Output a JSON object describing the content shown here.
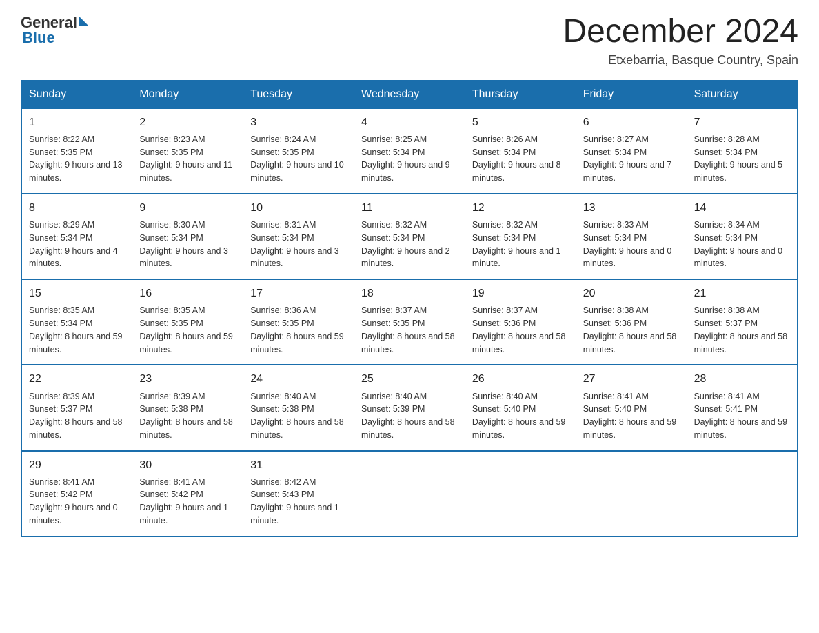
{
  "header": {
    "logo_general": "General",
    "logo_blue": "Blue",
    "month_title": "December 2024",
    "subtitle": "Etxebarria, Basque Country, Spain"
  },
  "weekdays": [
    "Sunday",
    "Monday",
    "Tuesday",
    "Wednesday",
    "Thursday",
    "Friday",
    "Saturday"
  ],
  "weeks": [
    [
      {
        "day": "1",
        "sunrise": "8:22 AM",
        "sunset": "5:35 PM",
        "daylight": "9 hours and 13 minutes."
      },
      {
        "day": "2",
        "sunrise": "8:23 AM",
        "sunset": "5:35 PM",
        "daylight": "9 hours and 11 minutes."
      },
      {
        "day": "3",
        "sunrise": "8:24 AM",
        "sunset": "5:35 PM",
        "daylight": "9 hours and 10 minutes."
      },
      {
        "day": "4",
        "sunrise": "8:25 AM",
        "sunset": "5:34 PM",
        "daylight": "9 hours and 9 minutes."
      },
      {
        "day": "5",
        "sunrise": "8:26 AM",
        "sunset": "5:34 PM",
        "daylight": "9 hours and 8 minutes."
      },
      {
        "day": "6",
        "sunrise": "8:27 AM",
        "sunset": "5:34 PM",
        "daylight": "9 hours and 7 minutes."
      },
      {
        "day": "7",
        "sunrise": "8:28 AM",
        "sunset": "5:34 PM",
        "daylight": "9 hours and 5 minutes."
      }
    ],
    [
      {
        "day": "8",
        "sunrise": "8:29 AM",
        "sunset": "5:34 PM",
        "daylight": "9 hours and 4 minutes."
      },
      {
        "day": "9",
        "sunrise": "8:30 AM",
        "sunset": "5:34 PM",
        "daylight": "9 hours and 3 minutes."
      },
      {
        "day": "10",
        "sunrise": "8:31 AM",
        "sunset": "5:34 PM",
        "daylight": "9 hours and 3 minutes."
      },
      {
        "day": "11",
        "sunrise": "8:32 AM",
        "sunset": "5:34 PM",
        "daylight": "9 hours and 2 minutes."
      },
      {
        "day": "12",
        "sunrise": "8:32 AM",
        "sunset": "5:34 PM",
        "daylight": "9 hours and 1 minute."
      },
      {
        "day": "13",
        "sunrise": "8:33 AM",
        "sunset": "5:34 PM",
        "daylight": "9 hours and 0 minutes."
      },
      {
        "day": "14",
        "sunrise": "8:34 AM",
        "sunset": "5:34 PM",
        "daylight": "9 hours and 0 minutes."
      }
    ],
    [
      {
        "day": "15",
        "sunrise": "8:35 AM",
        "sunset": "5:34 PM",
        "daylight": "8 hours and 59 minutes."
      },
      {
        "day": "16",
        "sunrise": "8:35 AM",
        "sunset": "5:35 PM",
        "daylight": "8 hours and 59 minutes."
      },
      {
        "day": "17",
        "sunrise": "8:36 AM",
        "sunset": "5:35 PM",
        "daylight": "8 hours and 59 minutes."
      },
      {
        "day": "18",
        "sunrise": "8:37 AM",
        "sunset": "5:35 PM",
        "daylight": "8 hours and 58 minutes."
      },
      {
        "day": "19",
        "sunrise": "8:37 AM",
        "sunset": "5:36 PM",
        "daylight": "8 hours and 58 minutes."
      },
      {
        "day": "20",
        "sunrise": "8:38 AM",
        "sunset": "5:36 PM",
        "daylight": "8 hours and 58 minutes."
      },
      {
        "day": "21",
        "sunrise": "8:38 AM",
        "sunset": "5:37 PM",
        "daylight": "8 hours and 58 minutes."
      }
    ],
    [
      {
        "day": "22",
        "sunrise": "8:39 AM",
        "sunset": "5:37 PM",
        "daylight": "8 hours and 58 minutes."
      },
      {
        "day": "23",
        "sunrise": "8:39 AM",
        "sunset": "5:38 PM",
        "daylight": "8 hours and 58 minutes."
      },
      {
        "day": "24",
        "sunrise": "8:40 AM",
        "sunset": "5:38 PM",
        "daylight": "8 hours and 58 minutes."
      },
      {
        "day": "25",
        "sunrise": "8:40 AM",
        "sunset": "5:39 PM",
        "daylight": "8 hours and 58 minutes."
      },
      {
        "day": "26",
        "sunrise": "8:40 AM",
        "sunset": "5:40 PM",
        "daylight": "8 hours and 59 minutes."
      },
      {
        "day": "27",
        "sunrise": "8:41 AM",
        "sunset": "5:40 PM",
        "daylight": "8 hours and 59 minutes."
      },
      {
        "day": "28",
        "sunrise": "8:41 AM",
        "sunset": "5:41 PM",
        "daylight": "8 hours and 59 minutes."
      }
    ],
    [
      {
        "day": "29",
        "sunrise": "8:41 AM",
        "sunset": "5:42 PM",
        "daylight": "9 hours and 0 minutes."
      },
      {
        "day": "30",
        "sunrise": "8:41 AM",
        "sunset": "5:42 PM",
        "daylight": "9 hours and 1 minute."
      },
      {
        "day": "31",
        "sunrise": "8:42 AM",
        "sunset": "5:43 PM",
        "daylight": "9 hours and 1 minute."
      },
      null,
      null,
      null,
      null
    ]
  ],
  "labels": {
    "sunrise": "Sunrise:",
    "sunset": "Sunset:",
    "daylight": "Daylight:"
  }
}
